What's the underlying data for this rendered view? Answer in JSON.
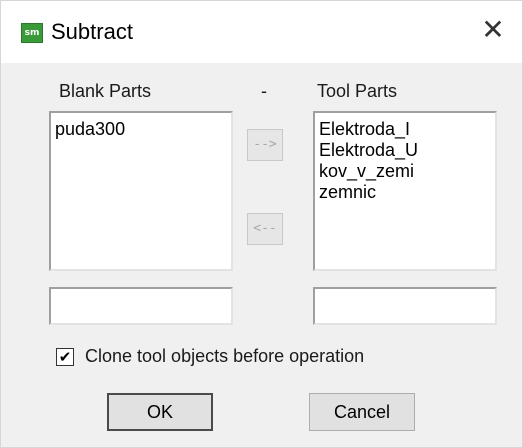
{
  "window": {
    "title": "Subtract",
    "icon": "app-logo-icon",
    "icon_text": "sm",
    "close_glyph": "✕"
  },
  "blank_parts": {
    "label": "Blank Parts",
    "items": [
      "puda300"
    ],
    "input_value": ""
  },
  "separator_label": "-",
  "tool_parts": {
    "label": "Tool Parts",
    "items": [
      "Elektroda_I",
      "Elektroda_U",
      "kov_v_zemi",
      "zemnic"
    ],
    "input_value": ""
  },
  "move_right_label": "-->",
  "move_left_label": "<--",
  "clone_option": {
    "label": "Clone tool objects before operation",
    "checked": true,
    "check_glyph": "✔"
  },
  "buttons": {
    "ok": "OK",
    "cancel": "Cancel"
  }
}
